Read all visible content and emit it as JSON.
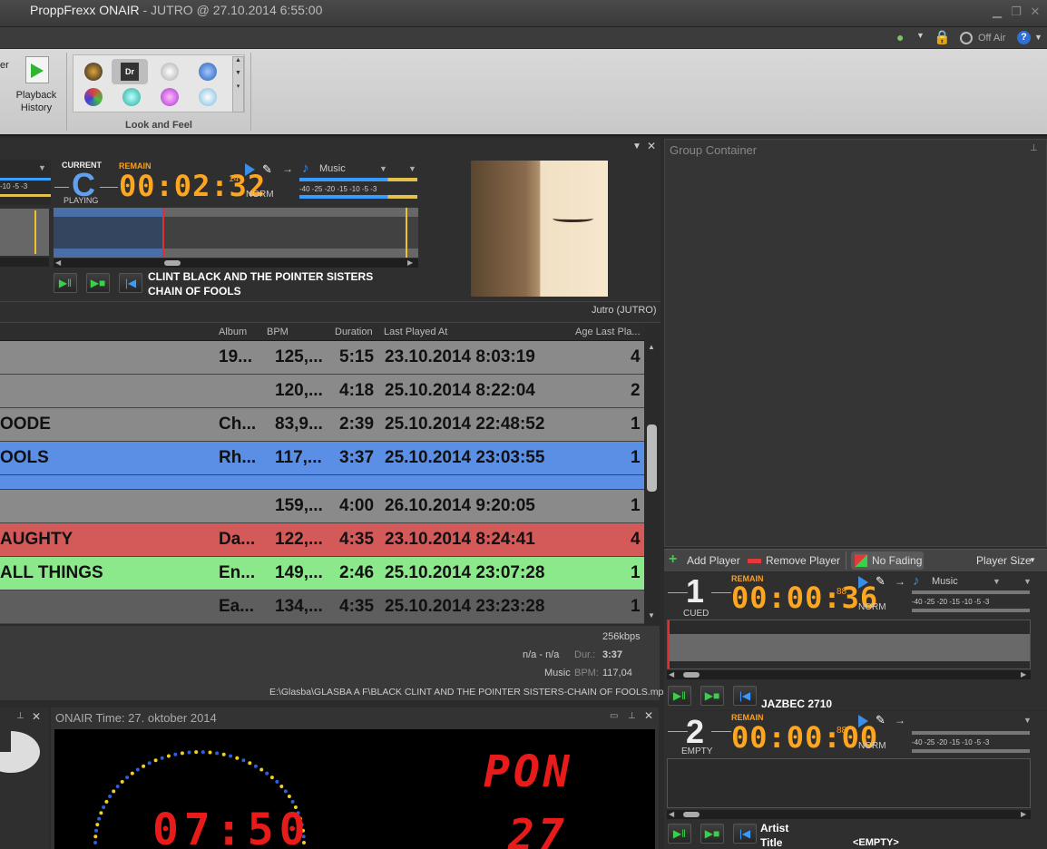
{
  "window": {
    "title": "ProppFrexx ONAIR",
    "subtitle": " - JUTRO @ 27.10.2014 6:55:00"
  },
  "toolbar": {
    "off_air_label": "Off Air",
    "partial_label": "er",
    "playback_history_label_1": "Playback",
    "playback_history_label_2": "History",
    "look_and_feel_caption": "Look and Feel",
    "skin_dr_label": "Dr"
  },
  "main_player": {
    "status_top": "CURRENT",
    "letter": "C",
    "status_bottom": "PLAYING",
    "remain_label": "REMAIN",
    "remain_time": "00:02:32",
    "remain_suffix": "14",
    "mode": "NORM",
    "category": "Music",
    "meter_scale": "-40  -25 -20  -15   -10    -5 -3",
    "side_meter_scale": "-10    -5 -3",
    "artist": "CLINT BLACK AND THE POINTER SISTERS",
    "title": "CHAIN OF FOOLS",
    "footer": "Jutro (JUTRO)"
  },
  "table": {
    "headers": [
      "Album",
      "BPM",
      "Duration",
      "Last Played At",
      "Age Last Pla..."
    ],
    "rows": [
      {
        "title": "",
        "album": "19...",
        "bpm": "125,...",
        "duration": "5:15",
        "last": "23.10.2014 8:03:19",
        "age": "4",
        "bg": "#8a8a8a"
      },
      {
        "title": "",
        "album": "",
        "bpm": "120,...",
        "duration": "4:18",
        "last": "25.10.2014 8:22:04",
        "age": "2",
        "bg": "#8a8a8a"
      },
      {
        "title": "OODE",
        "album": "Ch...",
        "bpm": "83,9...",
        "duration": "2:39",
        "last": "25.10.2014 22:48:52",
        "age": "1",
        "bg": "#8a8a8a"
      },
      {
        "title": "OOLS",
        "album": "Rh...",
        "bpm": "117,...",
        "duration": "3:37",
        "last": "25.10.2014 23:03:55",
        "age": "1",
        "bg": "#5b8fe6"
      },
      {
        "title": "",
        "album": "",
        "bpm": "159,...",
        "duration": "4:00",
        "last": "26.10.2014 9:20:05",
        "age": "1",
        "bg": "#8a8a8a"
      },
      {
        "title": "AUGHTY",
        "album": "Da...",
        "bpm": "122,...",
        "duration": "4:35",
        "last": "23.10.2014 8:24:41",
        "age": "4",
        "bg": "#d45a5a"
      },
      {
        "title": "ALL THINGS",
        "album": "En...",
        "bpm": "149,...",
        "duration": "2:46",
        "last": "25.10.2014 23:07:28",
        "age": "1",
        "bg": "#8be88b"
      },
      {
        "title": "",
        "album": "Ea...",
        "bpm": "134,...",
        "duration": "4:35",
        "last": "25.10.2014 23:23:28",
        "age": "1",
        "bg": "#5e5e5e"
      }
    ]
  },
  "info": {
    "bitrate": "256kbps",
    "na": "n/a - n/a",
    "dur_label": "Dur.:",
    "dur_value": "3:37",
    "category": "Music",
    "bpm_label": "BPM:",
    "bpm_value": "117,04",
    "path": "E:\\Glasba\\GLASBA A F\\BLACK CLINT AND THE POINTER SISTERS-CHAIN OF FOOLS.mp3"
  },
  "group": {
    "title": "Group Container",
    "add_player": "Add Player",
    "remove_player": "Remove Player",
    "no_fading": "No Fading",
    "player_size": "Player Size"
  },
  "player1": {
    "number": "1",
    "status": "CUED",
    "remain_label": "REMAIN",
    "time": "00:00:36",
    "suffix": "88",
    "mode": "NORM",
    "category": "Music",
    "meter_scale": "-40  -25 -20  -15   -10    -5 -3",
    "track": "JAZBEC 2710"
  },
  "player2": {
    "number": "2",
    "status": "EMPTY",
    "remain_label": "REMAIN",
    "time": "00:00:00",
    "suffix": "88",
    "mode": "NORM",
    "meter_scale": "-40  -25 -20  -15   -10    -5 -3",
    "artist_label": "Artist",
    "title_label": "Title",
    "empty": "<EMPTY>"
  },
  "clock": {
    "title": "ONAIR Time: 27. oktober 2014",
    "day": "PON",
    "date": "27",
    "time": "07:50"
  },
  "colors": {
    "accent_orange": "#ffa61f",
    "led_red": "#e81b1b",
    "row_blue": "#5b8fe6",
    "row_red": "#d45a5a",
    "row_green": "#8be88b"
  }
}
